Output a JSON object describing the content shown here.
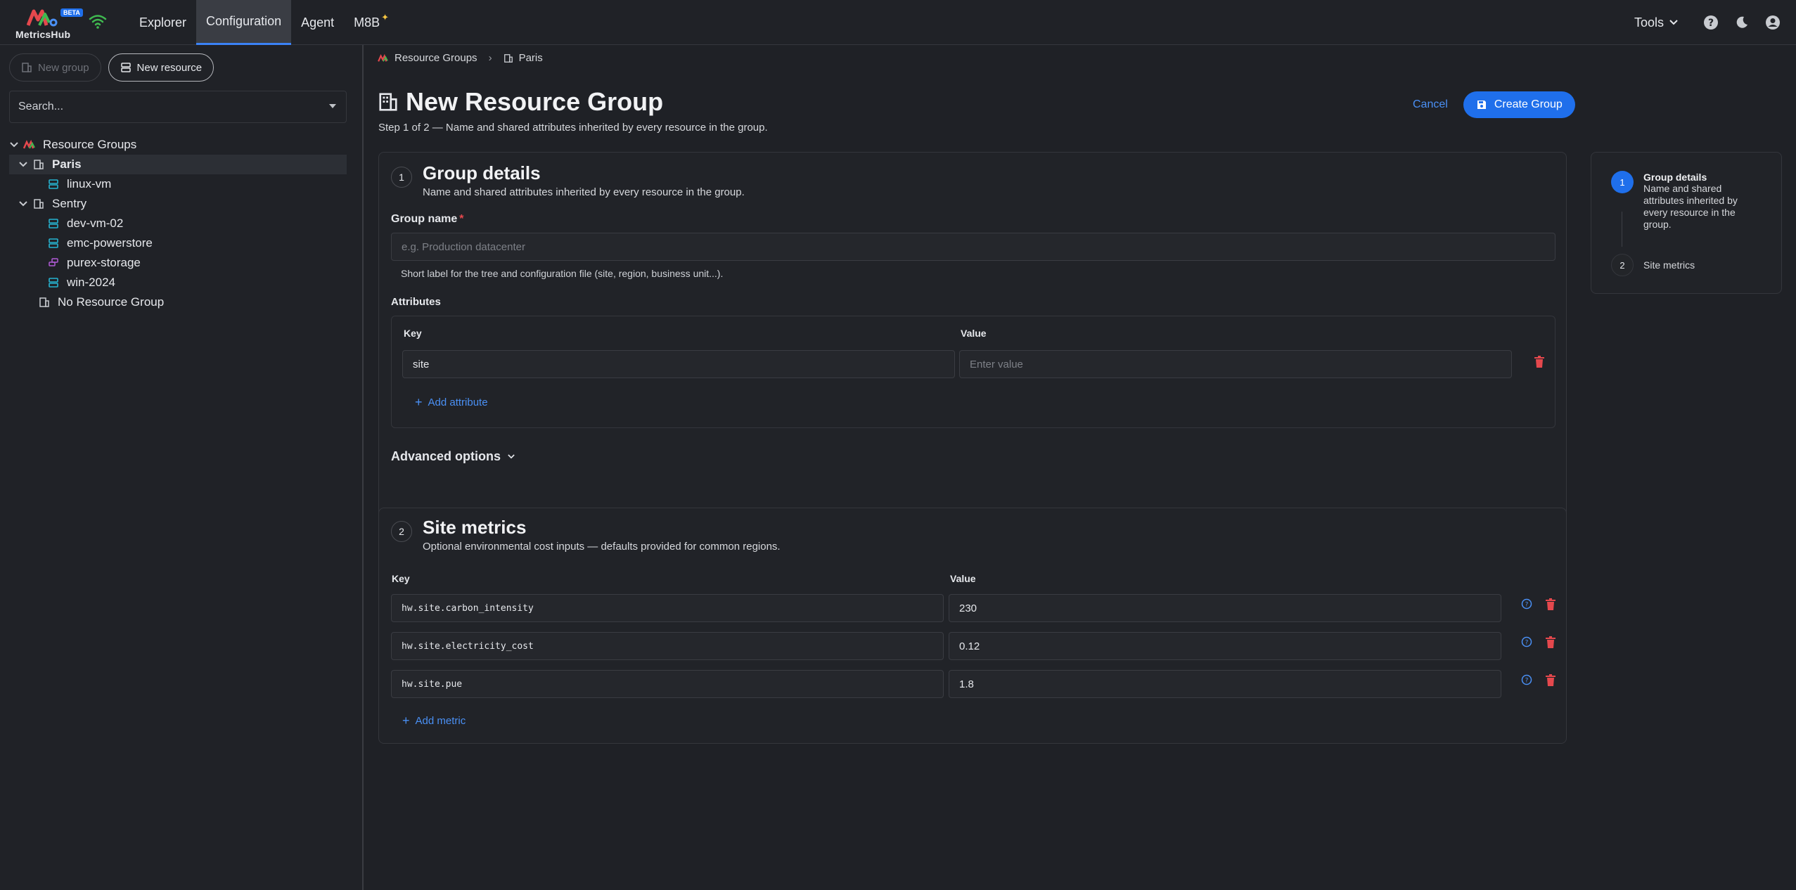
{
  "app": {
    "logo_text": "MetricsHub",
    "beta": "BETA",
    "nav": [
      "Explorer",
      "Configuration",
      "Agent",
      "M8B"
    ],
    "tools": "Tools",
    "accent": "#1f6feb"
  },
  "sidebar": {
    "new_group": "New group",
    "new_resource": "New resource",
    "search_placeholder": "Search...",
    "tree": {
      "root": "Resource Groups",
      "paris": "Paris",
      "linux_vm": "linux-vm",
      "sentry": "Sentry",
      "dev_vm_02": "dev-vm-02",
      "emc": "emc-powerstore",
      "purex": "purex-storage",
      "win": "win-2024",
      "none": "No Resource Group"
    }
  },
  "breadcrumb": {
    "root": "Resource Groups",
    "current": "Paris"
  },
  "header": {
    "title": "New Resource Group",
    "subtitle": "Step 1 of 2 — Name and shared attributes inherited by every resource in the group.",
    "cancel": "Cancel",
    "create": "Create Group"
  },
  "group_details": {
    "step": "1",
    "title": "Group details",
    "description": "Name and shared attributes inherited by every resource in the group.",
    "name_label": "Group name",
    "required": "*",
    "name_placeholder": "e.g. Production datacenter",
    "name_helper": "Short label for the tree and configuration file (site, region, business unit...).",
    "attributes_label": "Attributes",
    "key_header": "Key",
    "value_header": "Value",
    "attr_key": "site",
    "attr_value_placeholder": "Enter value",
    "add_attribute": "Add attribute",
    "advanced": "Advanced options"
  },
  "site_metrics": {
    "step": "2",
    "title": "Site metrics",
    "description": "Optional environmental cost inputs — defaults provided for common regions.",
    "key_header": "Key",
    "value_header": "Value",
    "rows": [
      {
        "key": "hw.site.carbon_intensity",
        "value": "230"
      },
      {
        "key": "hw.site.electricity_cost",
        "value": "0.12"
      },
      {
        "key": "hw.site.pue",
        "value": "1.8"
      }
    ],
    "add_metric": "Add metric"
  },
  "stepper": {
    "s1_num": "1",
    "s1_title": "Group details",
    "s1_desc": "Name and shared attributes inherited by every resource in the group.",
    "s2_num": "2",
    "s2_title": "Site metrics"
  }
}
